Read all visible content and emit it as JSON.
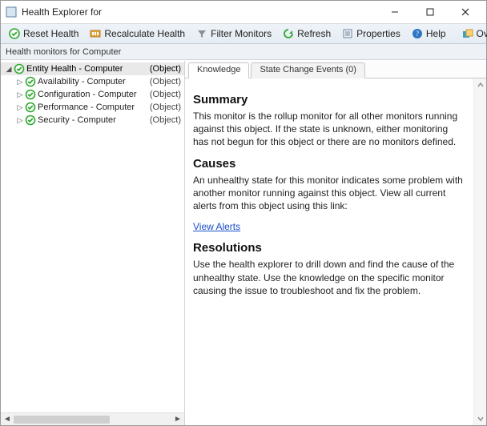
{
  "window": {
    "title": "Health Explorer for"
  },
  "toolbar": {
    "reset": "Reset Health",
    "recalculate": "Recalculate Health",
    "filter": "Filter Monitors",
    "refresh": "Refresh",
    "properties": "Properties",
    "help": "Help",
    "overrides": "Overrides"
  },
  "subheader": {
    "prefix": "Health monitors for",
    "target": "Computer"
  },
  "tree": {
    "rows": [
      {
        "expander": "◢",
        "indent": 0,
        "label": "Entity Health - ",
        "target": "Computer",
        "type": "(Object)",
        "selected": true
      },
      {
        "expander": "▷",
        "indent": 1,
        "label": "Availability - ",
        "target": "Computer",
        "type": "(Object)",
        "selected": false
      },
      {
        "expander": "▷",
        "indent": 1,
        "label": "Configuration - ",
        "target": "Computer",
        "type": "(Object)",
        "selected": false
      },
      {
        "expander": "▷",
        "indent": 1,
        "label": "Performance - ",
        "target": "Computer",
        "type": "(Object)",
        "selected": false
      },
      {
        "expander": "▷",
        "indent": 1,
        "label": "Security - ",
        "target": "Computer",
        "type": "(Object)",
        "selected": false
      }
    ]
  },
  "tabs": {
    "items": [
      {
        "label": "Knowledge",
        "active": true
      },
      {
        "label": "State Change Events (0)",
        "active": false
      }
    ]
  },
  "knowledge": {
    "summary_h": "Summary",
    "summary_p": "This monitor is the rollup monitor for all other monitors running against this object. If the state is unknown, either monitoring has not begun for this object or there are no monitors defined.",
    "causes_h": "Causes",
    "causes_p": "An unhealthy state for this monitor indicates some problem with another monitor running against this object. View all current alerts from this object using this link:",
    "view_alerts": "View Alerts",
    "res_h": "Resolutions",
    "res_p": "Use the health explorer to drill down and find the cause of the unhealthy state. Use the knowledge on the specific monitor causing the issue to troubleshoot and fix the problem."
  },
  "colors": {
    "health_green": "#2fa82f",
    "refresh_green": "#2fa82f",
    "help_blue": "#2b76c3",
    "filter_gray": "#8a8f94",
    "recalc_orange": "#e2a23a",
    "overrides_teal": "#3aa0c9"
  }
}
